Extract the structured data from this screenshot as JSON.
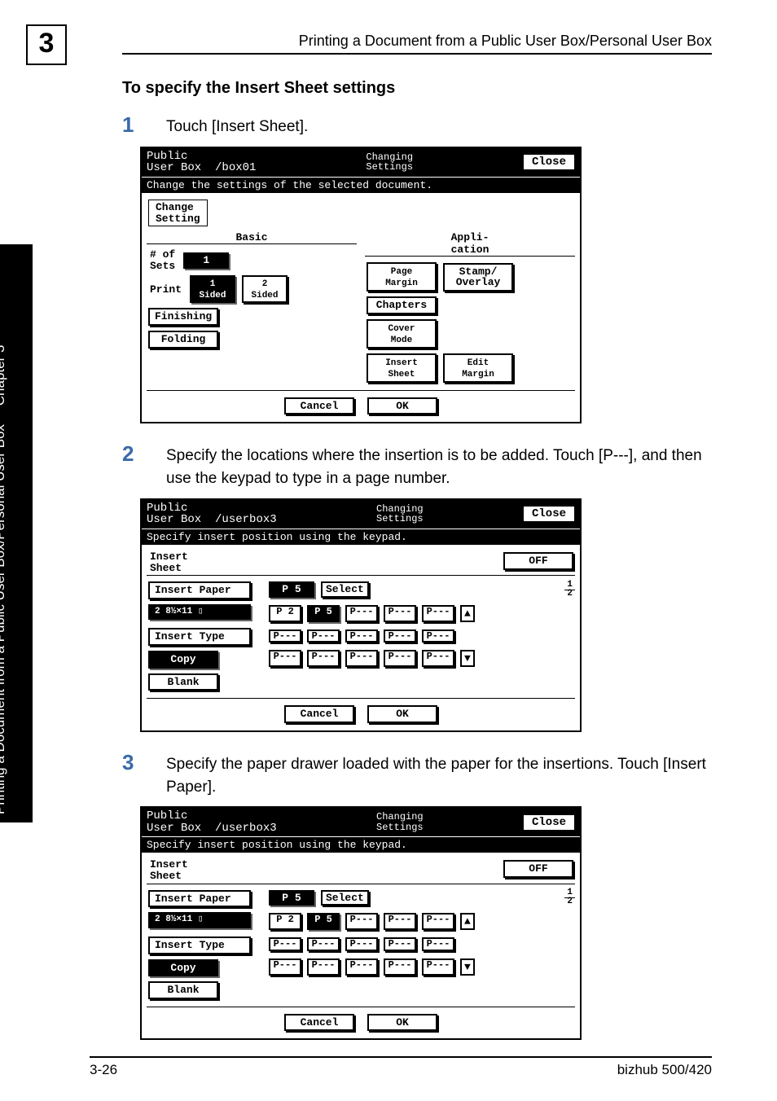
{
  "page": {
    "chapter_num": "3",
    "running_header": "Printing a Document from a Public User Box/Personal User Box",
    "sidebar_main": "Printing a Document from a Public User Box/Personal User Box",
    "sidebar_chapter": "Chapter 3",
    "section_title": "To specify the Insert Sheet settings",
    "footer_left": "3-26",
    "footer_right": "bizhub 500/420"
  },
  "steps": {
    "s1": {
      "num": "1",
      "text": "Touch [Insert Sheet]."
    },
    "s2": {
      "num": "2",
      "text": "Specify the locations where the insertion is to be added. Touch [P---], and then use the keypad to type in a page number."
    },
    "s3": {
      "num": "3",
      "text": "Specify the paper drawer loaded with the paper for the insertions. Touch [Insert Paper]."
    }
  },
  "screen1": {
    "title1": "Public",
    "title2": "User Box",
    "path": "/box01",
    "breadcrumb1": "Changing",
    "breadcrumb2": "Settings",
    "close": "Close",
    "instruction": "Change the settings of the selected document.",
    "tab_change1": "Change",
    "tab_change2": "Setting",
    "basic": "Basic",
    "appli1": "Appli-",
    "appli2": "cation",
    "sets1": "# of",
    "sets2": "Sets",
    "sets_val": "1",
    "page1": "Page",
    "page2": "Margin",
    "stampov": "Stamp/\nOverlay",
    "print": "Print",
    "sided1a": "1",
    "sided1b": "Sided",
    "sided2a": "2",
    "sided2b": "Sided",
    "chapters": "Chapters",
    "finishing": "Finishing",
    "cover1": "Cover",
    "cover2": "Mode",
    "folding": "Folding",
    "insert1": "Insert",
    "insert2": "Sheet",
    "edit1": "Edit",
    "edit2": "Margin",
    "cancel": "Cancel",
    "ok": "OK"
  },
  "screen2": {
    "title1": "Public",
    "title2": "User Box",
    "path": "/userbox3",
    "breadcrumb1": "Changing",
    "breadcrumb2": "Settings",
    "close": "Close",
    "instruction": "Specify insert position using the keypad.",
    "section1": "Insert",
    "section2": "Sheet",
    "off": "OFF",
    "ipaper": "Insert Paper",
    "tray": "2 8½×11 ▯",
    "p5": "P  5",
    "select": "Select",
    "frac_t": "1",
    "frac_b": "2",
    "p2": "P  2",
    "p5b": "P  5",
    "pdash": "P---",
    "itype": "Insert Type",
    "copy": "Copy",
    "blank": "Blank",
    "up": "▲",
    "down": "▼",
    "cancel": "Cancel",
    "ok": "OK"
  }
}
